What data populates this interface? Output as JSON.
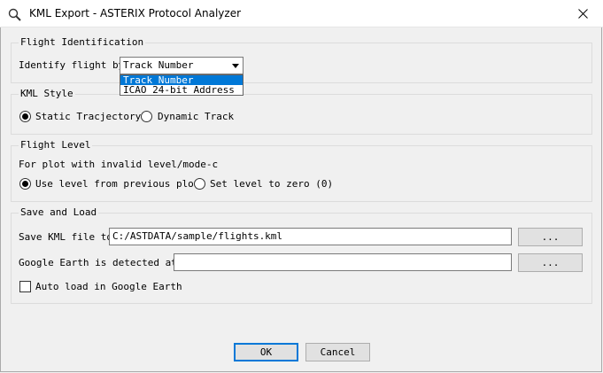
{
  "window": {
    "title": "KML Export - ASTERIX Protocol Analyzer",
    "icon": "app-icon",
    "close_icon": "close-icon"
  },
  "flight_identification": {
    "legend": "Flight Identification",
    "label": "Identify flight by",
    "selected": "Track Number",
    "options": [
      "Track Number",
      "ICAO 24-bit Address"
    ],
    "highlighted_option": "Track Number"
  },
  "kml_style": {
    "legend": "KML Style",
    "options": [
      {
        "label": "Static Tracjectory",
        "checked": true
      },
      {
        "label": "Dynamic Track",
        "checked": false
      }
    ]
  },
  "flight_level": {
    "legend": "Flight Level",
    "description": "For plot with invalid level/mode-c",
    "options": [
      {
        "label": "Use level from previous plot",
        "checked": true
      },
      {
        "label": "Set level to zero (0)",
        "checked": false
      }
    ]
  },
  "save_load": {
    "legend": "Save and Load",
    "save_label": "Save KML file to",
    "save_value": "C:/ASTDATA/sample/flights.kml",
    "save_browse": "...",
    "ge_label": "Google Earth is detected at",
    "ge_value": "",
    "ge_browse": "...",
    "autoload_label": "Auto load in Google Earth",
    "autoload_checked": false
  },
  "buttons": {
    "ok": "OK",
    "cancel": "Cancel"
  }
}
